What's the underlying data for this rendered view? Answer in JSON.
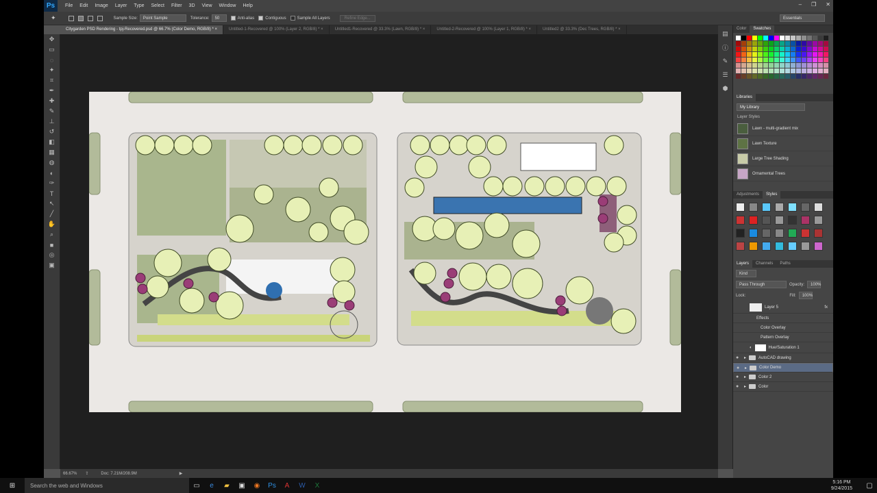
{
  "app": {
    "logo": "Ps"
  },
  "menu": [
    "File",
    "Edit",
    "Image",
    "Layer",
    "Type",
    "Select",
    "Filter",
    "3D",
    "View",
    "Window",
    "Help"
  ],
  "options": {
    "sample_size_label": "Sample Size:",
    "sample_size_value": "Point Sample",
    "tolerance_label": "Tolerance:",
    "tolerance_value": "50",
    "antialias": "Anti-alias",
    "contiguous": "Contiguous",
    "sample_all": "Sample All Layers",
    "refine": "Refine Edge...",
    "workspace": "Essentials"
  },
  "tabs": [
    "Citygarden PSD Rendering - tpj-Recovered.psd @ 66.7% (Color Demo, RGB/8) *",
    "Untitled-1-Recovered @ 100% (Layer 2, RGB/8) *",
    "Untitled1-Recovered @ 33.3% (Lawn, RGB/8) *",
    "Untitled-2-Recovered @ 100% (Layer 1, RGB/8) *",
    "Untitled2 @ 33.3% (Dec Trees, RGB/8) *"
  ],
  "status": {
    "zoom": "66.67%",
    "doc": "Doc: 7.21M/208.9M"
  },
  "panels": {
    "color_tab": "Color",
    "swatches_tab": "Swatches",
    "libraries_tab": "Libraries",
    "library_name": "My Library",
    "layer_styles_heading": "Layer Styles",
    "library_items": [
      "Lawn - multi-gradient mix",
      "Lawn Texture",
      "Large Tree Shading",
      "Ornamental Trees"
    ],
    "adjustments_tab": "Adjustments",
    "styles_tab": "Styles",
    "layers_tab": "Layers",
    "channels_tab": "Channels",
    "paths_tab": "Paths",
    "kind": "Kind",
    "blend": "Pass Through",
    "opacity_label": "Opacity:",
    "opacity_value": "100%",
    "lock_label": "Lock:",
    "fill_label": "Fill:",
    "fill_value": "100%",
    "layers": {
      "layer5": "Layer 5",
      "effects": "Effects",
      "color_overlay": "Color Overlay",
      "pattern_overlay": "Pattern Overlay",
      "hue_sat": "Hue/Saturation 1",
      "autocad": "AutoCAD drawing",
      "color_demo": "Color Demo",
      "color2": "Color 2",
      "color": "Color"
    }
  },
  "taskbar": {
    "search": "Search the web and Windows",
    "time": "5:16 PM",
    "date": "9/24/2015"
  },
  "colors": {
    "accent": "#31a8ff",
    "selected_layer": "#5b6b85"
  }
}
